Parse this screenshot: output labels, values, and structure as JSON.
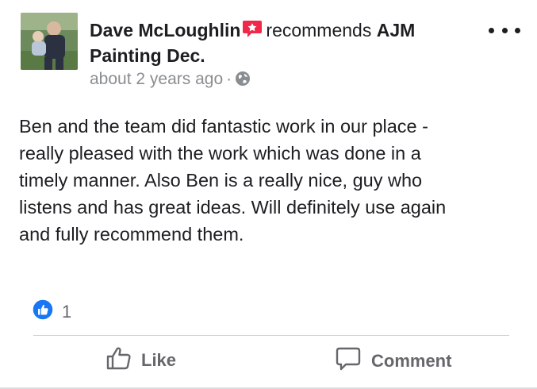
{
  "post": {
    "author": "Dave McLoughlin",
    "verb": "recommends",
    "page_name": "AJM Painting Dec.",
    "time": "about 2 years ago",
    "separator": "·",
    "audience_icon": "globe-icon",
    "body": "Ben and the team did fantastic work in our place -\nreally pleased with the work which was done in a\ntimely manner. Also Ben is a really nice, guy who\nlistens and has great ideas. Will definitely use again\nand fully recommend them.",
    "reaction_count": "1"
  },
  "actions": {
    "like_label": "Like",
    "comment_label": "Comment"
  },
  "colors": {
    "recommend_icon": "#f0284a",
    "like_blue": "#1877f2",
    "muted": "#65676b"
  }
}
